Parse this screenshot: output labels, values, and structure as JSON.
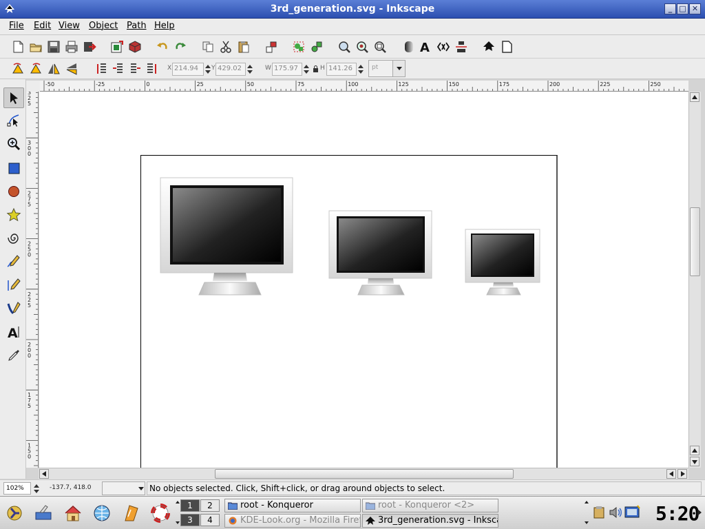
{
  "window": {
    "title": "3rd_generation.svg - Inkscape"
  },
  "menu": [
    "File",
    "Edit",
    "View",
    "Object",
    "Path",
    "Help"
  ],
  "toolbar_icons": [
    "new-doc-icon",
    "open-icon",
    "save-icon",
    "print-icon",
    "import-icon",
    "export-icon",
    "import-3d-icon",
    "undo-icon",
    "redo-icon",
    "copy-icon",
    "cut-icon",
    "paste-icon",
    "duplicate-icon",
    "group-icon",
    "ungroup-icon",
    "zoom-selection-icon",
    "zoom-drawing-icon",
    "zoom-page-icon",
    "fill-stroke-icon",
    "text-icon",
    "xml-editor-icon",
    "align-icon",
    "inkscape-prefs-icon",
    "document-props-icon"
  ],
  "controls": {
    "x_label": "X",
    "x_value": "214.94",
    "y_label": "Y",
    "y_value": "429.02",
    "w_label": "W",
    "w_value": "175.97",
    "h_label": "H",
    "h_value": "141.26",
    "unit": "pt"
  },
  "tools": [
    "selector-tool-icon",
    "node-tool-icon",
    "zoom-tool-icon",
    "rect-tool-icon",
    "ellipse-tool-icon",
    "star-tool-icon",
    "spiral-tool-icon",
    "pencil-tool-icon",
    "pen-tool-icon",
    "calligraphy-tool-icon",
    "text-tool-icon",
    "dropper-tool-icon"
  ],
  "ruler": {
    "h_ticks": [
      "-50",
      "-25",
      "0",
      "25",
      "50",
      "75",
      "100",
      "125",
      "150",
      "175",
      "200",
      "225",
      "250"
    ],
    "v_ticks": [
      "325",
      "300",
      "275",
      "250",
      "225",
      "200",
      "175",
      "150"
    ]
  },
  "status": {
    "zoom": "102%",
    "coords": "-137.7,   418.0",
    "message": "No objects selected. Click, Shift+click, or drag around objects to select."
  },
  "taskbar": {
    "desktops": [
      "1",
      "2",
      "3",
      "4"
    ],
    "tasks": [
      {
        "label": "root - Konqueror"
      },
      {
        "label": "root - Konqueror <2>"
      },
      {
        "label": "KDE-Look.org - Mozilla Firefox"
      },
      {
        "label": "3rd_generation.svg - Inkscape"
      }
    ],
    "clock": "5:20"
  },
  "colors": {
    "titlebar": "#2c4fb0",
    "accent": "#3a5fc8"
  }
}
